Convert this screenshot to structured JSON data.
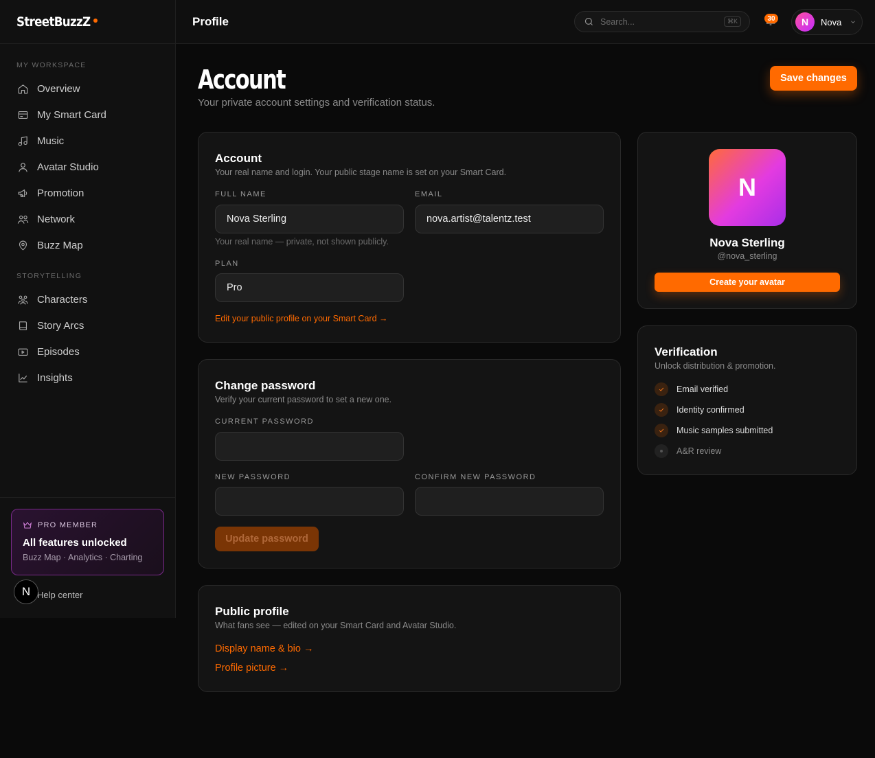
{
  "brand": {
    "name": "StreetBuzzZ"
  },
  "sidebar": {
    "workspace_label": "MY WORKSPACE",
    "workspace_items": [
      {
        "label": "Overview",
        "icon": "home-icon"
      },
      {
        "label": "My Smart Card",
        "icon": "card-icon"
      },
      {
        "label": "Music",
        "icon": "music-icon"
      },
      {
        "label": "Avatar Studio",
        "icon": "user-icon"
      },
      {
        "label": "Promotion",
        "icon": "megaphone-icon"
      },
      {
        "label": "Network",
        "icon": "network-icon"
      },
      {
        "label": "Buzz Map",
        "icon": "map-pin-icon"
      }
    ],
    "storytelling_label": "STORYTELLING",
    "storytelling_items": [
      {
        "label": "Characters",
        "icon": "characters-icon"
      },
      {
        "label": "Story Arcs",
        "icon": "book-icon"
      },
      {
        "label": "Episodes",
        "icon": "episodes-icon"
      },
      {
        "label": "Insights",
        "icon": "chart-icon"
      }
    ],
    "pro": {
      "badge": "PRO MEMBER",
      "title": "All features unlocked",
      "subtitle": "Buzz Map · Analytics · Charting"
    },
    "help": "Help center",
    "n_badge": "N"
  },
  "header": {
    "crumb": "Profile",
    "search_placeholder": "Search...",
    "search_kbd": "⌘K",
    "notifications": "30",
    "user_initial": "N",
    "user_name": "Nova"
  },
  "page": {
    "title": "Account",
    "subtitle": "Your private account settings and verification status.",
    "save_label": "Save changes"
  },
  "account_card": {
    "title": "Account",
    "desc": "Your real name and login. Your public stage name is set on your Smart Card.",
    "full_name_label": "FULL NAME",
    "full_name_value": "Nova Sterling",
    "full_name_hint": "Your real name — private, not shown publicly.",
    "email_label": "EMAIL",
    "email_value": "nova.artist@talentz.test",
    "plan_label": "PLAN",
    "plan_value": "Pro",
    "edit_link": "Edit your public profile on your Smart Card →"
  },
  "password_card": {
    "title": "Change password",
    "desc": "Verify your current password to set a new one.",
    "current_label": "CURRENT PASSWORD",
    "new_label": "NEW PASSWORD",
    "confirm_label": "CONFIRM NEW PASSWORD",
    "update_label": "Update password"
  },
  "public_card": {
    "title": "Public profile",
    "desc": "What fans see — edited on your Smart Card and Avatar Studio.",
    "link1": "Display name & bio →",
    "link2": "Profile picture →"
  },
  "profile_card": {
    "initial": "N",
    "name": "Nova Sterling",
    "handle": "@nova_sterling",
    "avatar_button": "Create your avatar"
  },
  "verification": {
    "title": "Verification",
    "desc": "Unlock distribution & promotion.",
    "items": [
      {
        "label": "Email verified",
        "done": true
      },
      {
        "label": "Identity confirmed",
        "done": true
      },
      {
        "label": "Music samples submitted",
        "done": true
      },
      {
        "label": "A&R review",
        "done": false
      }
    ]
  },
  "colors": {
    "accent": "#ff6a00",
    "background": "#0a0a0a",
    "card": "#141414"
  }
}
